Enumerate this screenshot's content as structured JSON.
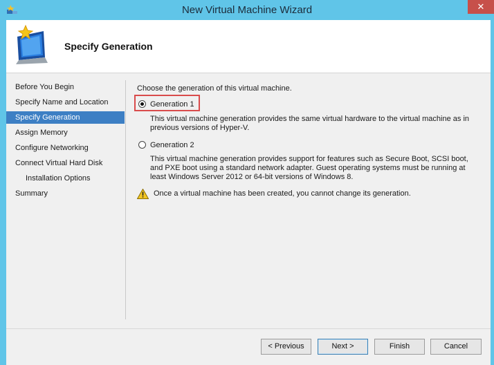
{
  "window": {
    "title": "New Virtual Machine Wizard",
    "close_label": "✕"
  },
  "header": {
    "page_title": "Specify Generation"
  },
  "steps": [
    {
      "label": "Before You Begin"
    },
    {
      "label": "Specify Name and Location"
    },
    {
      "label": "Specify Generation",
      "active": true
    },
    {
      "label": "Assign Memory"
    },
    {
      "label": "Configure Networking"
    },
    {
      "label": "Connect Virtual Hard Disk"
    },
    {
      "label": "Installation Options",
      "sub": true
    },
    {
      "label": "Summary"
    }
  ],
  "content": {
    "intro": "Choose the generation of this virtual machine.",
    "gen1": {
      "label": "Generation 1",
      "selected": true,
      "desc": "This virtual machine generation provides the same virtual hardware to the virtual machine as in previous versions of Hyper-V."
    },
    "gen2": {
      "label": "Generation 2",
      "selected": false,
      "desc": "This virtual machine generation provides support for features such as Secure Boot, SCSI boot, and PXE boot using a standard network adapter. Guest operating systems must be running at least Windows Server 2012 or 64-bit versions of Windows 8."
    },
    "warning": "Once a virtual machine has been created, you cannot change its generation."
  },
  "buttons": {
    "previous": "< Previous",
    "next": "Next >",
    "finish": "Finish",
    "cancel": "Cancel"
  },
  "colors": {
    "titlebar": "#60c5e8",
    "active_step": "#3d7fc4",
    "highlight_box": "#d94b4b",
    "close_button": "#c7504a"
  },
  "icons": {
    "app": "hyper-v-icon",
    "wizard": "monitor-star-icon",
    "warning": "warning-triangle-icon"
  }
}
